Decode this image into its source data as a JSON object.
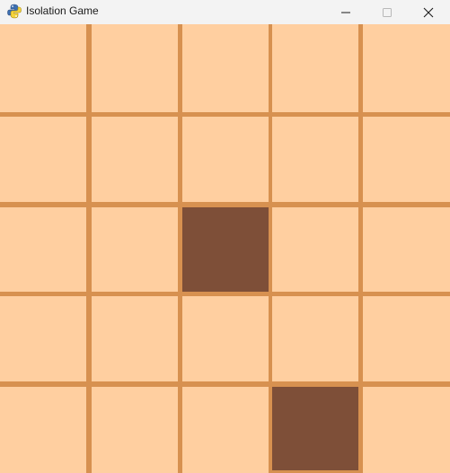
{
  "window": {
    "title": "Isolation Game",
    "app_icon": "python-pygame-icon",
    "controls": {
      "minimize": "minimize-icon",
      "maximize": "maximize-icon",
      "close": "close-icon"
    }
  },
  "board": {
    "rows": 5,
    "cols": 5,
    "blocked_cells": [
      [
        2,
        2
      ],
      [
        4,
        3
      ]
    ],
    "colors": {
      "open_cell": "#ffcfa0",
      "blocked_cell": "#7e4f38",
      "grid_line": "#d79150",
      "titlebar": "#f3f3f3"
    }
  }
}
